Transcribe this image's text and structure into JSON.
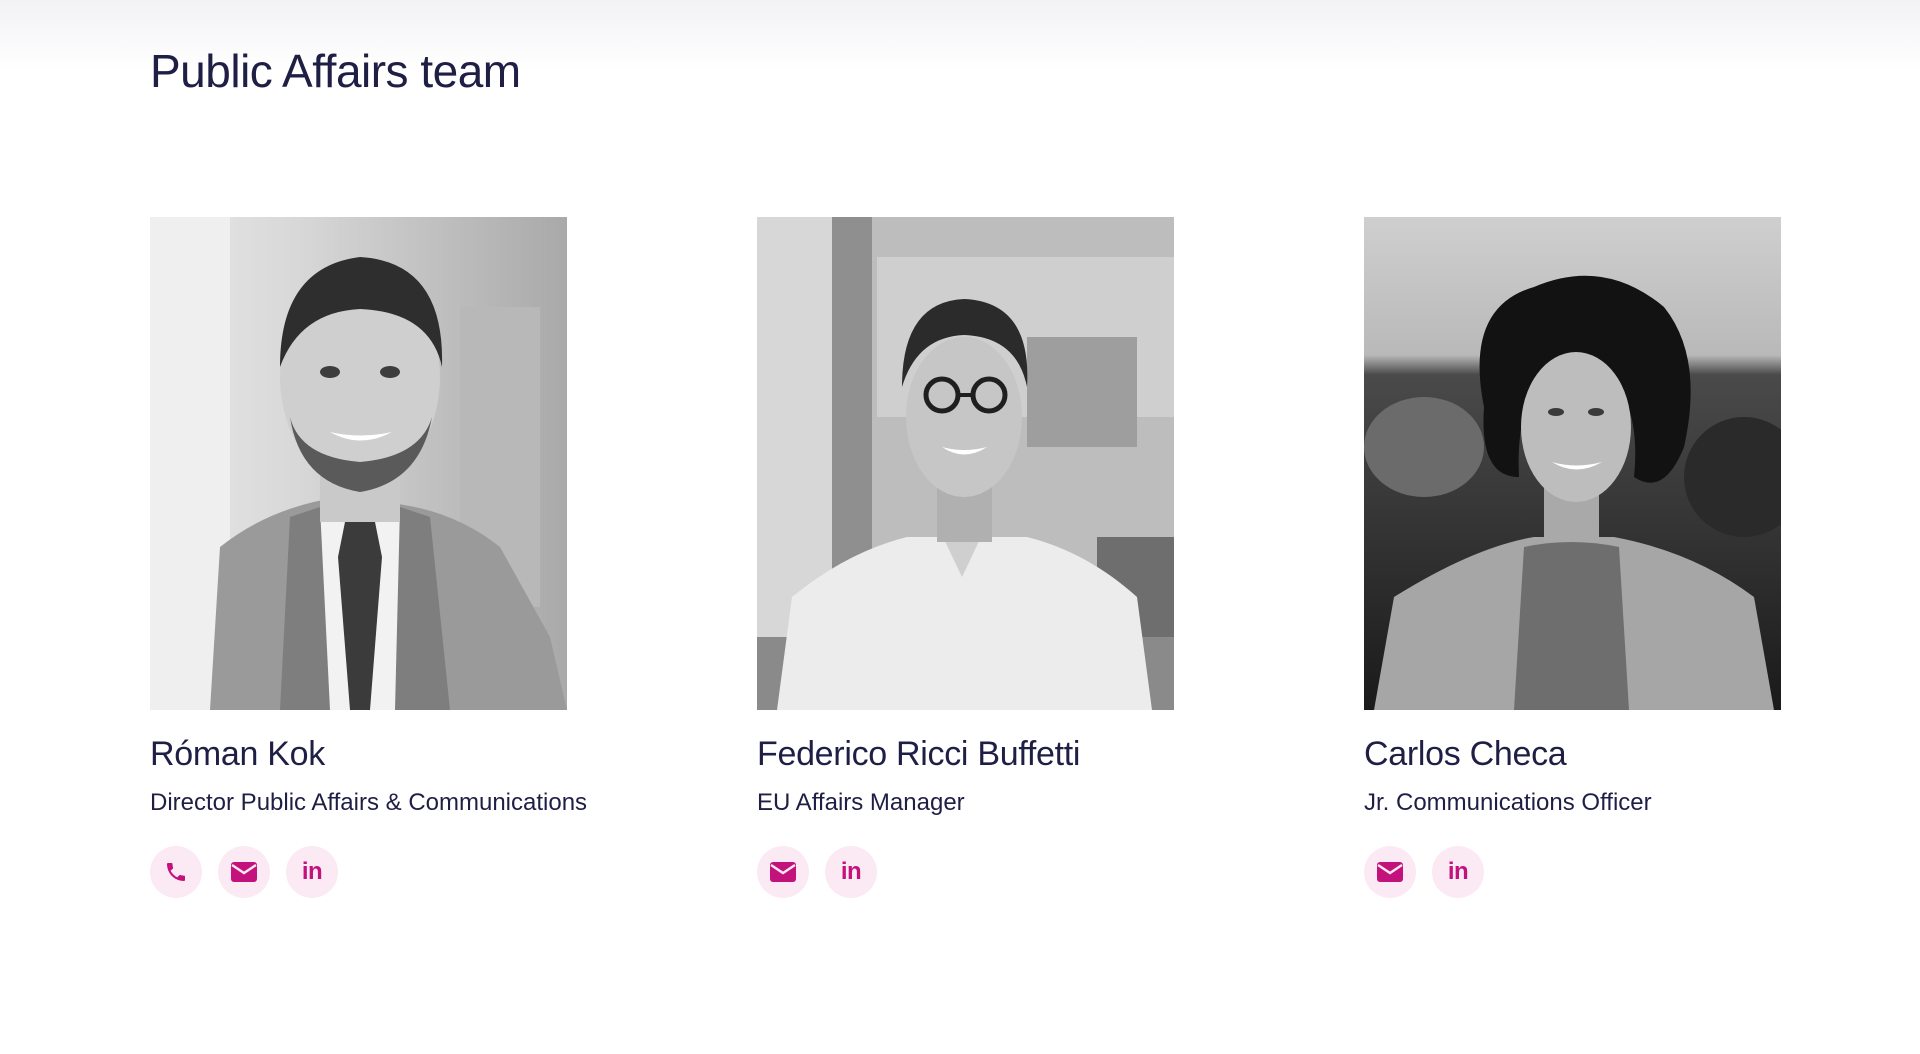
{
  "section": {
    "title": "Public Affairs team"
  },
  "colors": {
    "text": "#1f1f45",
    "accent": "#c4127c",
    "icon_bg": "#fbeaf3"
  },
  "members": [
    {
      "name": "Róman Kok",
      "role": "Director Public Affairs & Communications",
      "photo": "grayscale portrait photo",
      "contacts": [
        "phone-icon",
        "email-icon",
        "linkedin-icon"
      ]
    },
    {
      "name": "Federico Ricci Buffetti",
      "role": "EU Affairs Manager",
      "photo": "grayscale portrait photo",
      "contacts": [
        "email-icon",
        "linkedin-icon"
      ]
    },
    {
      "name": "Carlos Checa",
      "role": "Jr. Communications Officer",
      "photo": "grayscale portrait photo",
      "contacts": [
        "email-icon",
        "linkedin-icon"
      ]
    }
  ],
  "icons": {
    "linkedin_label": "in"
  }
}
